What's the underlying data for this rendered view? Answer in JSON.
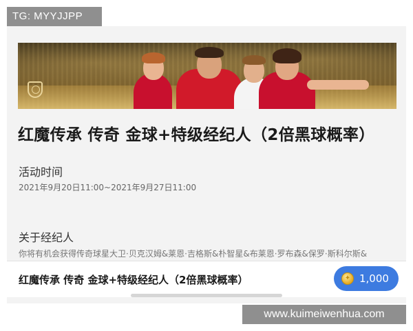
{
  "watermark_top": "TG: MYYJJPP",
  "banner": {
    "description": ""
  },
  "title": "红魔传承 传奇 金球+特级经纪人（2倍黑球概率）",
  "activity_time": {
    "label": "活动时间",
    "range": "2021年9月20日11:00~2021年9月27日11:00"
  },
  "about_agent": {
    "label": "关于经纪人",
    "text": "你将有机会获得传奇球星大卫·贝克汉姆&莱恩·吉格斯&朴智星&布莱恩·罗布森&保罗·斯科尔斯&"
  },
  "bottom_bar": {
    "title": "红魔传承 传奇 金球+特级经纪人（2倍黑球概率）",
    "price": "1,000",
    "coin_icon": "coin-icon",
    "button_color": "#3d7be0"
  },
  "watermark_bottom": "www.kuimeiwenhua.com",
  "colors": {
    "accent": "#3d7be0",
    "team_red": "#c8102e"
  }
}
